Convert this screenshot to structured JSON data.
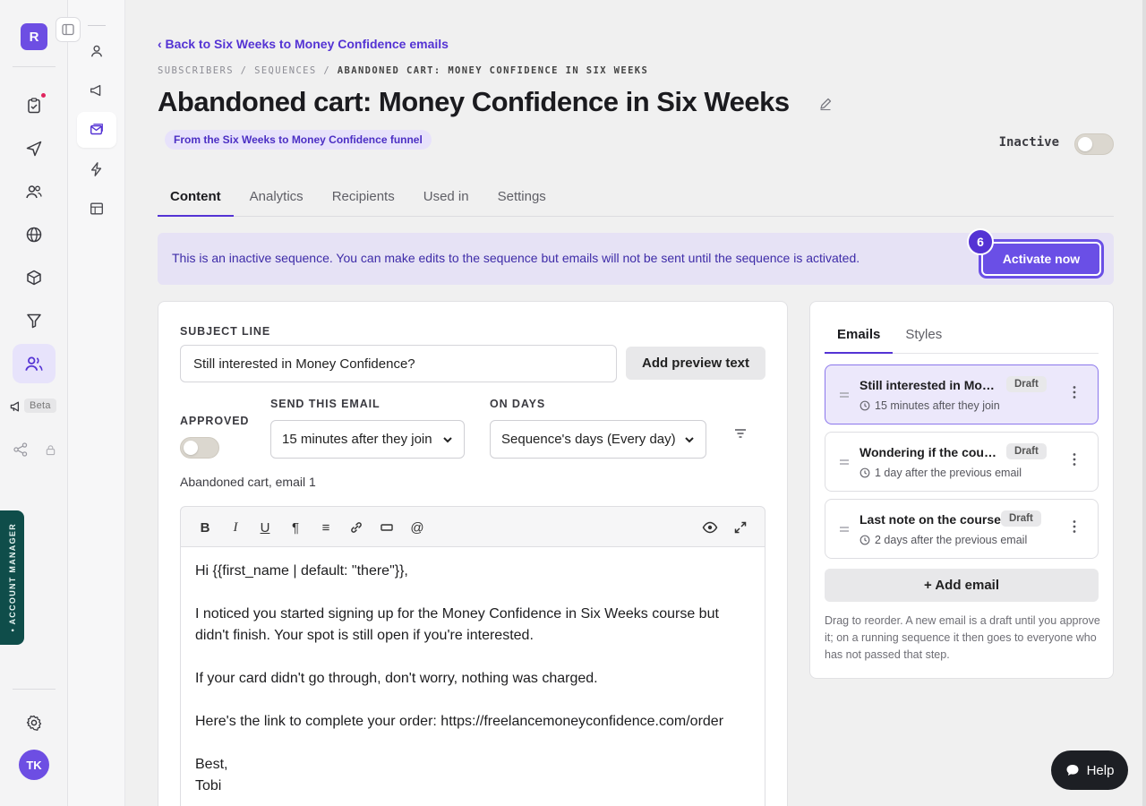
{
  "app": {
    "logo_letter": "R",
    "beta_label": "Beta",
    "account_manager_label": "• ACCOUNT MANAGER",
    "user_initials": "TK"
  },
  "header": {
    "back_link": "‹ Back to Six Weeks to Money Confidence emails",
    "breadcrumb": [
      "SUBSCRIBERS",
      "SEQUENCES",
      "ABANDONED CART: MONEY CONFIDENCE IN SIX WEEKS"
    ],
    "breadcrumb_sep": " / ",
    "title": "Abandoned cart: Money Confidence in Six Weeks",
    "funnel_badge": "From the Six Weeks to Money Confidence funnel",
    "status_label": "Inactive",
    "status_active": false
  },
  "tabs": [
    "Content",
    "Analytics",
    "Recipients",
    "Used in",
    "Settings"
  ],
  "active_tab": "Content",
  "banner": {
    "message": "This is an inactive sequence. You can make edits to the sequence but emails will not be sent until the sequence is activated.",
    "activate_button": "Activate now",
    "step_badge": "6"
  },
  "editor": {
    "subject_label": "SUBJECT LINE",
    "subject_value": "Still interested in Money Confidence?",
    "add_preview_button": "Add preview text",
    "approved_label": "APPROVED",
    "approved": false,
    "send_label": "SEND THIS EMAIL",
    "send_value": "15 minutes after they join",
    "days_label": "ON DAYS",
    "days_value": "Sequence's days (Every day)",
    "email_caption": "Abandoned cart, email 1",
    "body_lines": [
      "Hi {{first_name | default: \"there\"}},",
      "",
      "I noticed you started signing up for the Money Confidence in Six Weeks course but didn't finish. Your spot is still open if you're interested.",
      "",
      "If your card didn't go through, don't worry, nothing was charged.",
      "",
      "Here's the link to complete your order: https://freelancemoneyconfidence.com/order",
      "",
      "Best,",
      "Tobi"
    ]
  },
  "panel": {
    "tabs": [
      "Emails",
      "Styles"
    ],
    "active_tab": "Emails",
    "emails": [
      {
        "title": "Still interested in Money Confidence?",
        "status": "Draft",
        "timing": "15 minutes after they join",
        "selected": true
      },
      {
        "title": "Wondering if the course is right for you?",
        "status": "Draft",
        "timing": "1 day after the previous email",
        "selected": false
      },
      {
        "title": "Last note on the course",
        "status": "Draft",
        "timing": "2 days after the previous email",
        "selected": false
      }
    ],
    "add_email_button": "+ Add email",
    "hint": "Drag to reorder. A new email is a draft until you approve it; on a running sequence it then goes to everyone who has not passed that step."
  },
  "help_button": "Help",
  "colors": {
    "accent": "#6a4fe6",
    "accent_dark": "#5433d4",
    "badge_bg": "#e7e2fb",
    "account_tab": "#0f4d4a"
  }
}
